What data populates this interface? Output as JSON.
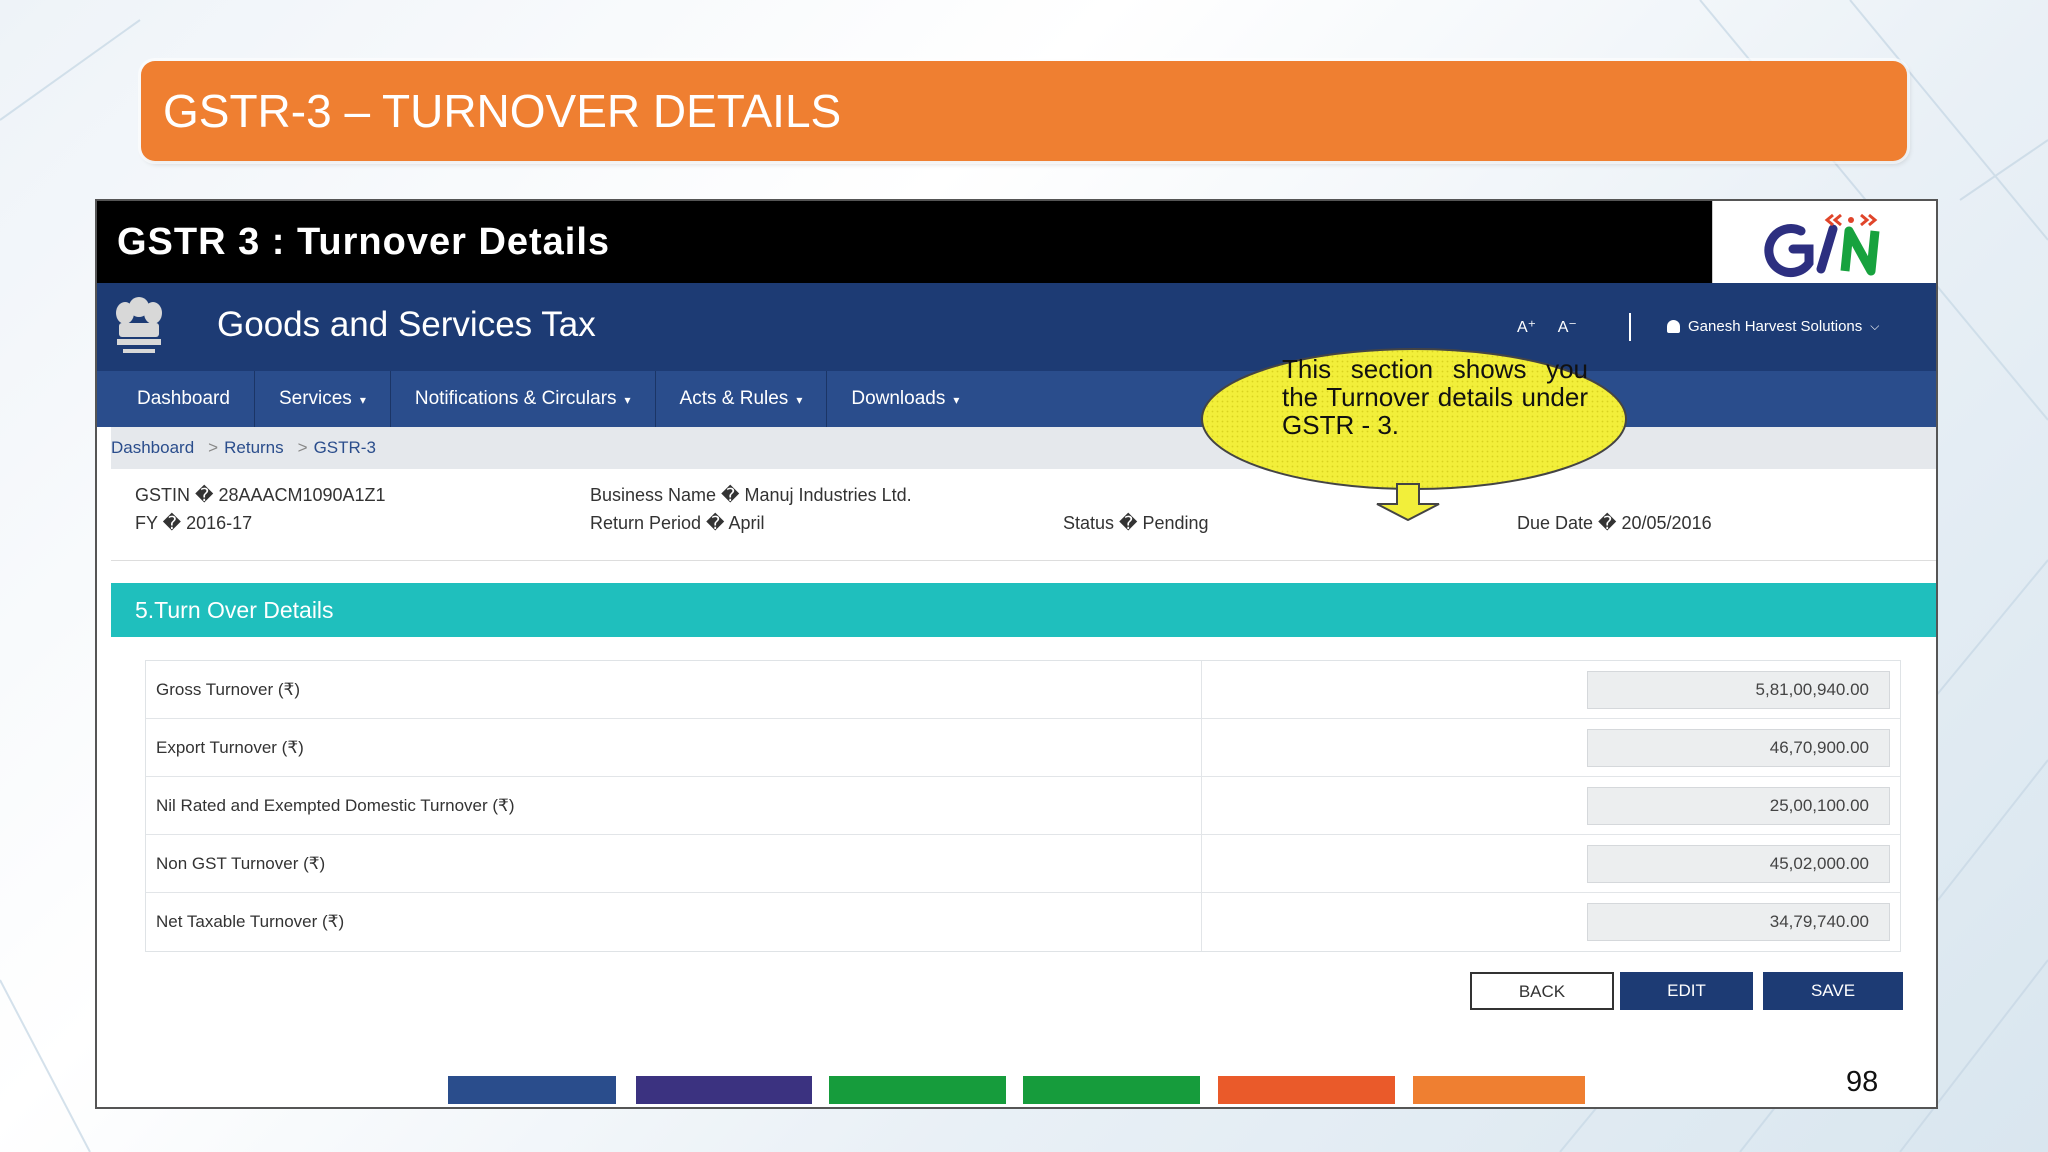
{
  "slide": {
    "title": "GSTR-3 – TURNOVER DETAILS",
    "page_number": "98"
  },
  "screen": {
    "header_title": "GSTR 3 : Turnover Details",
    "gst_title": "Goods and Services Tax",
    "font_increase": "A⁺",
    "font_decrease": "A⁻",
    "user_name": "Ganesh Harvest Solutions",
    "nav": [
      {
        "label": "Dashboard",
        "caret": ""
      },
      {
        "label": "Services",
        "caret": "▾"
      },
      {
        "label": "Notifications & Circulars",
        "caret": "▾"
      },
      {
        "label": "Acts & Rules",
        "caret": "▾"
      },
      {
        "label": "Downloads",
        "caret": "▾"
      }
    ],
    "breadcrumb": [
      "Dashboard",
      "Returns",
      "GSTR-3"
    ],
    "breadcrumb_sep": ">",
    "info": {
      "gstin": "GSTIN � 28AAACM1090A1Z1",
      "fy": "FY � 2016-17",
      "business_name": "Business Name � Manuj Industries Ltd.",
      "return_period": "Return Period � April",
      "status": "Status � Pending",
      "due_date": "Due Date � 20/05/2016"
    },
    "section_title": "5.Turn Over Details",
    "rows": [
      {
        "label": "Gross Turnover (₹)",
        "value": "5,81,00,940.00"
      },
      {
        "label": "Export Turnover (₹)",
        "value": "46,70,900.00"
      },
      {
        "label": "Nil Rated and Exempted Domestic Turnover (₹)",
        "value": "25,00,100.00"
      },
      {
        "label": "Non GST Turnover (₹)",
        "value": "45,02,000.00"
      },
      {
        "label": "Net Taxable Turnover (₹)",
        "value": "34,79,740.00"
      }
    ],
    "buttons": {
      "back": "BACK",
      "edit": "EDIT",
      "save": "SAVE"
    },
    "callout": "This section shows you the Turnover details under GSTR - 3."
  },
  "colors": {
    "title_bar": "#ef7f31",
    "gst_bar": "#1d3b74",
    "nav_bar": "#2a4d8c",
    "section_bar": "#1fbfbd",
    "callout_fill": "#f2ef3a",
    "strip": [
      "#2a4d8c",
      "#3b3280",
      "#169c3c",
      "#169c3c",
      "#ea5a2a",
      "#ef7f31"
    ]
  },
  "icons": [
    "ashoka-emblem-icon",
    "gstn-logo-icon",
    "user-icon",
    "chevron-down-icon",
    "down-arrow-icon"
  ]
}
